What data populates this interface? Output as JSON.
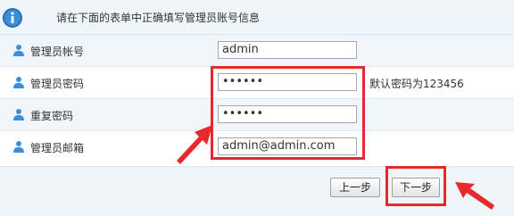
{
  "header": {
    "text": "请在下面的表单中正确填写管理员账号信息"
  },
  "form": {
    "rows": [
      {
        "label": "管理员帐号",
        "value": "admin"
      },
      {
        "label": "管理员密码",
        "value": "••••••",
        "hint": "默认密码为123456"
      },
      {
        "label": "重复密码",
        "value": "••••••"
      },
      {
        "label": "管理员邮箱",
        "value": "admin@admin.com"
      }
    ]
  },
  "buttons": {
    "prev_label": "上一步",
    "next_label": "下一步"
  },
  "colors": {
    "highlight": "#e8282b",
    "header_bg": "#eef5fb",
    "icon_blue": "#3a8fd8"
  },
  "icons": {
    "header": "info-icon",
    "row": "user-icon",
    "annotation": "red-arrow-icon"
  }
}
